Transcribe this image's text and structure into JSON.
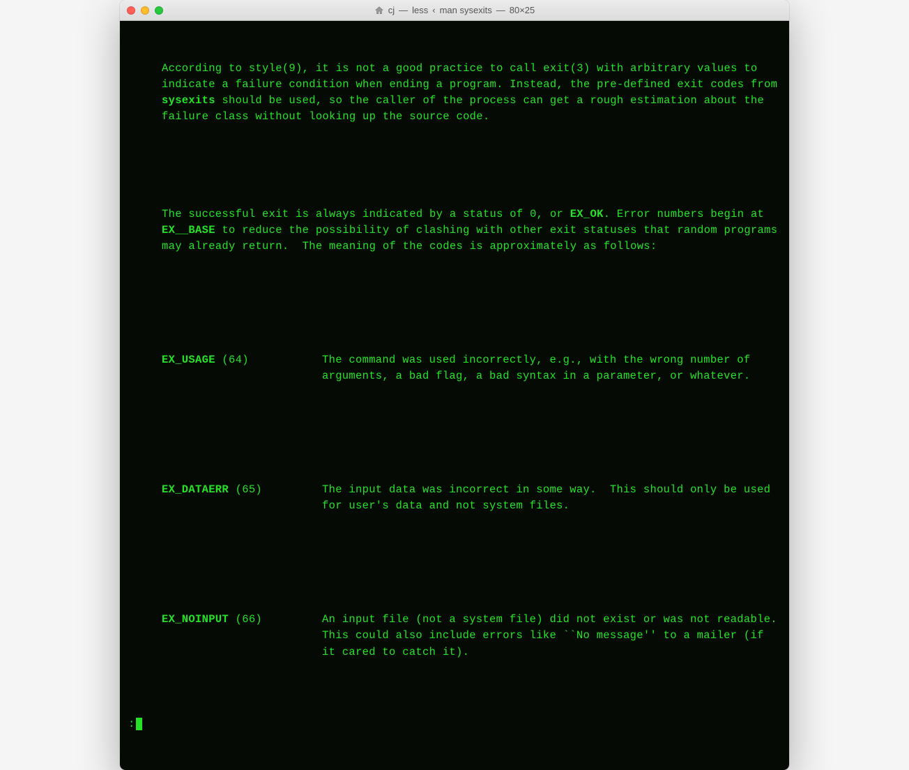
{
  "titlebar": {
    "folder": "cj",
    "process": "less",
    "chevron": "‹",
    "command": "man sysexits",
    "size": "80×25"
  },
  "content": {
    "para1_pre": "According to style(9), it is not a good practice to call exit(3) with arbitrary values to indicate a failure condition when ending a program. Instead, the pre-defined exit codes from ",
    "sysexits": "sysexits",
    "para1_post": " should be used, so the caller of the process can get a rough estimation about the failure class without looking up the source code.",
    "para2_pre": "The successful exit is always indicated by a status of 0, or ",
    "ex_ok": "EX_OK",
    "para2_mid": ". Error numbers begin at ",
    "ex_base": "EX__BASE",
    "para2_post": " to reduce the possibility of clashing with other exit statuses that random programs may already return.  The meaning of the codes is approximately as follows:",
    "entries": [
      {
        "name": "EX_USAGE",
        "code": " (64)",
        "desc": "The command was used incorrectly, e.g., with the wrong number of arguments, a bad flag, a bad syntax in a parameter, or whatever."
      },
      {
        "name": "EX_DATAERR",
        "code": " (65)",
        "desc": "The input data was incorrect in some way.  This should only be used for user's data and not system files."
      },
      {
        "name": "EX_NOINPUT",
        "code": " (66)",
        "desc": "An input file (not a system file) did not exist or was not readable.  This could also include errors like ``No message'' to a mailer (if it cared to catch it)."
      }
    ]
  },
  "prompt": ":"
}
